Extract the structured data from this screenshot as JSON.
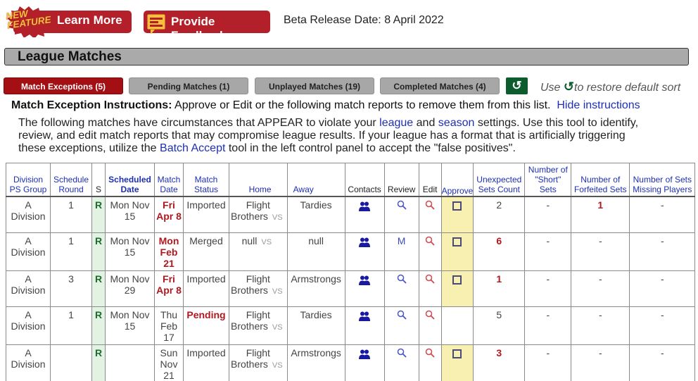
{
  "top_bar": {
    "new_feature_badge": "NEW FEATURE",
    "learn_more_label": "Learn More",
    "feedback_label": "Provide Feedback",
    "beta_release": "Beta Release Date: 8 April 2022"
  },
  "section": {
    "title": "League Matches"
  },
  "tabs": [
    {
      "label": "Match Exceptions (5)",
      "active": true
    },
    {
      "label": "Pending Matches (1)",
      "active": false
    },
    {
      "label": "Unplayed Matches (19)",
      "active": false
    },
    {
      "label": "Completed Matches (4)",
      "active": false
    }
  ],
  "restore": {
    "icon": "restore-sort-icon",
    "glyph": "↺",
    "hint_prefix": "Use",
    "hint_suffix": "to restore default sort"
  },
  "instructions": {
    "title_bold": "Match Exception Instructions:",
    "title_text": "Approve or Edit or the following match reports to remove them from this list.",
    "hide_link": "Hide instructions",
    "body_1": "The following matches have circumstances that APPEAR to violate your",
    "link_league": "league",
    "body_and": "and",
    "link_season": "season",
    "body_2": "settings. Use this tool to identify, review, and edit match reports that may compromise league results. If your league has a format that is artificially triggering these exceptions, utilize the",
    "link_batch": "Batch Accept",
    "body_3": "tool in the left control panel to accept the \"false positives\"."
  },
  "table": {
    "headers": {
      "division": "Division PS Group",
      "round": "Schedule Round",
      "s": "S",
      "scheduled_date": "Scheduled Date",
      "match_date": "Match Date",
      "match_status": "Match Status",
      "home": "Home",
      "away": "Away",
      "contacts": "Contacts",
      "review": "Review",
      "edit": "Edit",
      "approve": "Approve",
      "unexpected": "Unexpected Sets Count",
      "short": "Number of \"Short\" Sets",
      "forfeited": "Number of Forfeited Sets",
      "missing": "Number of Sets Missing Players"
    },
    "vs_label": "VS",
    "rows": [
      {
        "division": "A Division",
        "round": "1",
        "s": "R",
        "scheduled_date": "Mon Nov 15",
        "match_date": "Fri Apr 8",
        "match_date_flag": true,
        "status": "Imported",
        "status_flag": false,
        "home": "Flight Brothers",
        "away": "Tardies",
        "review": "search",
        "approve": true,
        "unexpected": "2",
        "unexpected_flag": false,
        "short": "-",
        "forfeited": "1",
        "forfeited_flag": true,
        "missing": "-"
      },
      {
        "division": "A Division",
        "round": "1",
        "s": "R",
        "scheduled_date": "Mon Nov 15",
        "match_date": "Mon Feb 21",
        "match_date_flag": true,
        "status": "Merged",
        "status_flag": false,
        "home": "null",
        "away": "null",
        "review": "M",
        "approve": true,
        "unexpected": "6",
        "unexpected_flag": true,
        "short": "-",
        "forfeited": "-",
        "forfeited_flag": false,
        "missing": "-"
      },
      {
        "division": "A Division",
        "round": "3",
        "s": "R",
        "scheduled_date": "Mon Nov 29",
        "match_date": "Fri Apr 8",
        "match_date_flag": true,
        "status": "Imported",
        "status_flag": false,
        "home": "Flight Brothers",
        "away": "Armstrongs",
        "review": "search",
        "approve": true,
        "unexpected": "1",
        "unexpected_flag": true,
        "short": "-",
        "forfeited": "-",
        "forfeited_flag": false,
        "missing": "-"
      },
      {
        "division": "A Division",
        "round": "1",
        "s": "R",
        "scheduled_date": "Mon Nov 15",
        "match_date": "Thu Feb 17",
        "match_date_flag": false,
        "status": "Pending",
        "status_flag": true,
        "home": "Flight Brothers",
        "away": "Tardies",
        "review": "search",
        "approve": false,
        "unexpected": "5",
        "unexpected_flag": false,
        "short": "-",
        "forfeited": "-",
        "forfeited_flag": false,
        "missing": "-"
      },
      {
        "division": "A Division",
        "round": "",
        "s": "R",
        "scheduled_date": "",
        "match_date": "Sun Nov 21",
        "match_date_flag": false,
        "status": "Imported",
        "status_flag": false,
        "home": "Flight Brothers",
        "away": "Armstrongs",
        "review": "search",
        "approve": true,
        "unexpected": "3",
        "unexpected_flag": true,
        "short": "-",
        "forfeited": "-",
        "forfeited_flag": false,
        "missing": "-"
      }
    ]
  },
  "colors": {
    "brand_red": "#b4202a",
    "active_tab": "#a30f12",
    "inactive_tab": "#a7a7a7",
    "restore_green": "#0d5c2e",
    "link_blue": "#1d2fb5",
    "flag_red": "#b01820",
    "approve_bg": "#f8f0b0",
    "s_col_bg": "#e3f3e3"
  }
}
